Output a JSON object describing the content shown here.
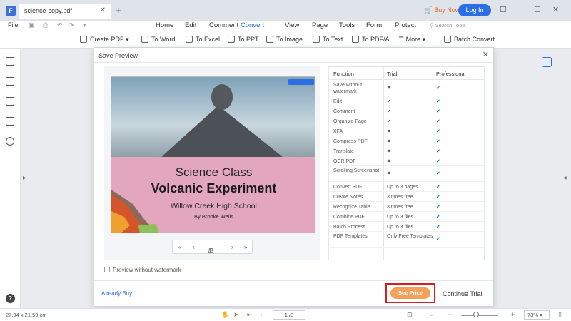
{
  "titlebar": {
    "doc_tab": "science-copy.pdf",
    "buy_now": "Buy Now",
    "login": "Log In"
  },
  "menu": {
    "file": "File",
    "items": [
      "Home",
      "Edit",
      "Comment",
      "Convert",
      "View",
      "Page",
      "Tools",
      "Form",
      "Protect"
    ],
    "active": "Convert",
    "search_placeholder": "Search Tools"
  },
  "toolbar": {
    "create_pdf": "Create PDF",
    "to_word": "To Word",
    "to_excel": "To Excel",
    "to_ppt": "To PPT",
    "to_image": "To Image",
    "to_text": "To Text",
    "to_pdfa": "To PDF/A",
    "more": "More",
    "batch_convert": "Batch Convert"
  },
  "modal": {
    "title": "Save Preview",
    "preview": {
      "line1": "Science Class",
      "line2": "Volcanic Experiment",
      "school": "Willow Creek High School",
      "author": "By Brooke Wells"
    },
    "pager": {
      "current": "1",
      "total": "/3"
    },
    "watermark_label": "Preview without watermark",
    "table": {
      "headers": [
        "Function",
        "Trial",
        "Professional"
      ],
      "rows": [
        {
          "function": "Save without watermark",
          "trial": "x",
          "pro": "check"
        },
        {
          "function": "Edit",
          "trial": "check",
          "pro": "check"
        },
        {
          "function": "Comment",
          "trial": "check",
          "pro": "check"
        },
        {
          "function": "Organize Page",
          "trial": "check",
          "pro": "check"
        },
        {
          "function": "XFA",
          "trial": "x",
          "pro": "check"
        },
        {
          "function": "Compress PDF",
          "trial": "x",
          "pro": "check"
        },
        {
          "function": "Translate",
          "trial": "x",
          "pro": "check"
        },
        {
          "function": "OCR PDF",
          "trial": "x",
          "pro": "check"
        },
        {
          "function": "Scrolling Screenshot",
          "trial": "x",
          "pro": "check"
        },
        {
          "function": "Convert PDF",
          "trial": "Up to 3 pages",
          "pro": "check"
        },
        {
          "function": "Create Notes",
          "trial": "3 times free",
          "pro": "check"
        },
        {
          "function": "Recognize Table",
          "trial": "3 times free",
          "pro": "check"
        },
        {
          "function": "Combine PDF",
          "trial": "Up to 3 files",
          "pro": "check"
        },
        {
          "function": "Batch Process",
          "trial": "Up to 3 files",
          "pro": "check"
        },
        {
          "function": "PDF Templates",
          "trial": "Only Free Templates",
          "pro": "check"
        }
      ]
    },
    "already_buy": "Already Buy",
    "see_price": "See Price",
    "continue_trial": "Continue Trial"
  },
  "status": {
    "dimensions": "27.94 x 21.59 cm",
    "page": "1 /3",
    "zoom": "73%"
  },
  "colors": {
    "accent": "#2c6ee6",
    "buy_now": "#e8692b",
    "see_price": "#f6a15a",
    "highlight_frame": "#d81e1e",
    "cover_pink": "#e3a7bd"
  }
}
